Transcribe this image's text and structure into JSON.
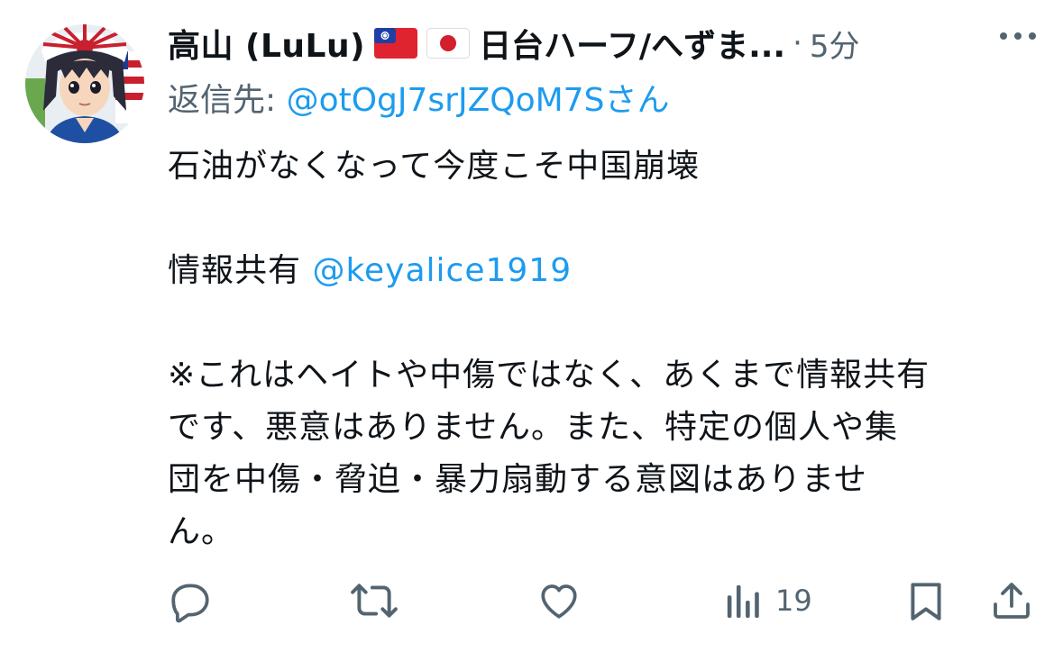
{
  "author": {
    "name": "高山 (LuLu)",
    "flags": [
      "taiwan-flag",
      "japan-flag"
    ],
    "name_suffix": "日台ハーフ/へずま...",
    "separator": "·",
    "time": "5分"
  },
  "reply": {
    "prefix": "返信先: ",
    "handle": "@otOgJ7srJZQoM7S",
    "suffix": "さん"
  },
  "content": {
    "line1": "石油がなくなって今度こそ中国崩壊",
    "line2_prefix": "情報共有 ",
    "line2_mention": "@keyalice1919",
    "line3": "※これはヘイトや中傷ではなく、あくまで情報共有",
    "line4": "です、悪意はありません。また、特定の個人や集",
    "line5": "団を中傷・脅迫・暴力扇動する意図はありませ",
    "line6": "ん。"
  },
  "actions": {
    "reply_icon": "reply-icon",
    "retweet_icon": "retweet-icon",
    "like_icon": "heart-icon",
    "views_icon": "views-bar-icon",
    "views_count": "19",
    "bookmark_icon": "bookmark-icon",
    "share_icon": "share-icon"
  },
  "colors": {
    "text": "#0f1419",
    "secondary": "#536471",
    "link": "#1d9bf0",
    "background": "#ffffff"
  }
}
